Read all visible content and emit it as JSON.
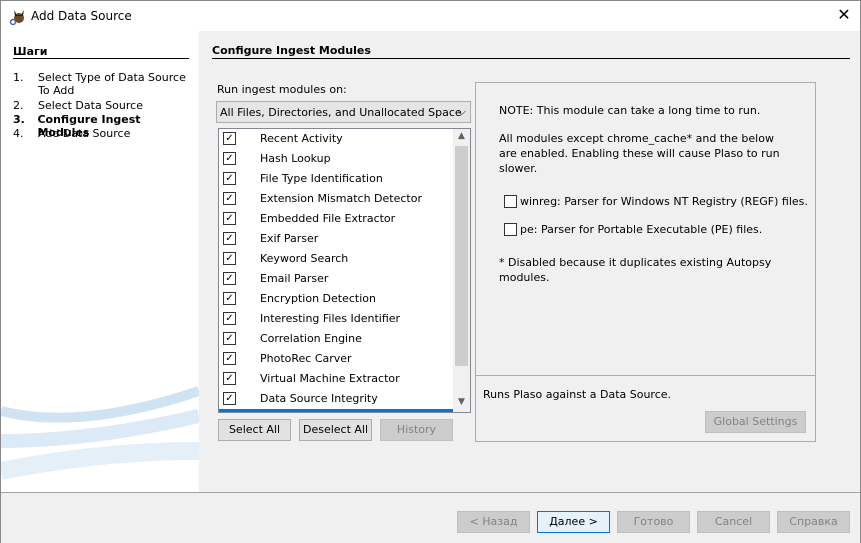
{
  "window": {
    "title": "Add Data Source",
    "close_icon": "close-icon"
  },
  "steps": {
    "header": "Шаги",
    "items": [
      {
        "num": "1.",
        "label": "Select Type of Data Source To Add",
        "current": false
      },
      {
        "num": "2.",
        "label": "Select Data Source",
        "current": false
      },
      {
        "num": "3.",
        "label": "Configure Ingest Modules",
        "current": true
      },
      {
        "num": "4.",
        "label": "Add Data Source",
        "current": false
      }
    ]
  },
  "main": {
    "header": "Configure Ingest Modules",
    "run_on_label": "Run ingest modules on:",
    "run_on_value": "All Files, Directories, and Unallocated Space",
    "modules": [
      {
        "label": "Recent Activity",
        "checked": true
      },
      {
        "label": "Hash Lookup",
        "checked": true
      },
      {
        "label": "File Type Identification",
        "checked": true
      },
      {
        "label": "Extension Mismatch Detector",
        "checked": true
      },
      {
        "label": "Embedded File Extractor",
        "checked": true
      },
      {
        "label": "Exif Parser",
        "checked": true
      },
      {
        "label": "Keyword Search",
        "checked": true
      },
      {
        "label": "Email Parser",
        "checked": true
      },
      {
        "label": "Encryption Detection",
        "checked": true
      },
      {
        "label": "Interesting Files Identifier",
        "checked": true
      },
      {
        "label": "Correlation Engine",
        "checked": true
      },
      {
        "label": "PhotoRec Carver",
        "checked": true
      },
      {
        "label": "Virtual Machine Extractor",
        "checked": true
      },
      {
        "label": "Data Source Integrity",
        "checked": true
      }
    ],
    "select_all": "Select All",
    "deselect_all": "Deselect All",
    "history": "History"
  },
  "settings": {
    "note": "NOTE: This module can take a long time to run.",
    "desc": "All modules except chrome_cache* and the below are enabled.  Enabling these will cause Plaso to run slower.",
    "opt1": "winreg: Parser for Windows NT Registry (REGF) files.",
    "opt2": "pe: Parser for Portable Executable (PE) files.",
    "footnote": "* Disabled because it duplicates existing Autopsy modules.",
    "module_desc": "Runs Plaso against a Data Source.",
    "global_settings": "Global Settings"
  },
  "footer": {
    "back": "< Назад",
    "next": "Далее >",
    "finish": "Готово",
    "cancel": "Cancel",
    "help": "Справка"
  },
  "colors": {
    "selection": "#0078d7"
  }
}
